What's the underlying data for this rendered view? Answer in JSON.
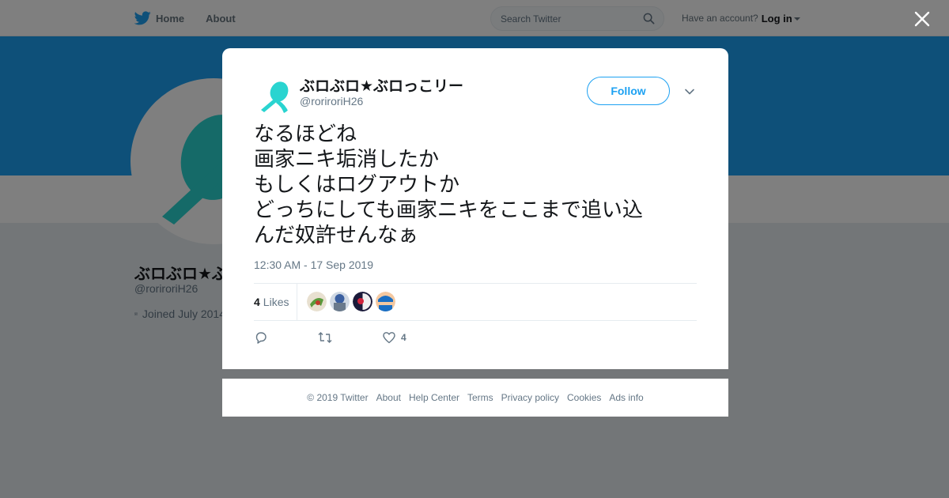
{
  "nav": {
    "home_label": "Home",
    "about_label": "About",
    "search_placeholder": "Search Twitter",
    "account_prompt": "Have an account?",
    "login_label": "Log in"
  },
  "profile": {
    "name": "ぶロぶロ★ぶロっこリー",
    "handle": "@roriroriH26",
    "joined": "Joined July 2014"
  },
  "tweet": {
    "author_name": "ぶロぶロ★ぶロっこリー",
    "author_handle": "@roriroriH26",
    "follow_label": "Follow",
    "text_lines": [
      "なるほどね",
      "画家ニキ垢消したか",
      "もしくはログアウトか",
      "どっちにしても画家ニキをここまで追い込",
      "んだ奴許せんなぁ"
    ],
    "timestamp": "12:30 AM - 17 Sep 2019",
    "likes_count": "4",
    "likes_label": "Likes",
    "like_action_count": "4"
  },
  "footer": {
    "links": [
      "© 2019 Twitter",
      "About",
      "Help Center",
      "Terms",
      "Privacy policy",
      "Cookies",
      "Ads info"
    ]
  },
  "colors": {
    "twitter_blue": "#1da1f2",
    "avatar_teal": "#2ad4d0",
    "overlay": "rgba(0,0,0,0.5)"
  },
  "icons": [
    "twitter-bird-icon",
    "search-icon",
    "caret-down-icon",
    "close-icon",
    "chevron-down-icon",
    "reply-icon",
    "retweet-icon",
    "heart-icon",
    "calendar-icon"
  ]
}
